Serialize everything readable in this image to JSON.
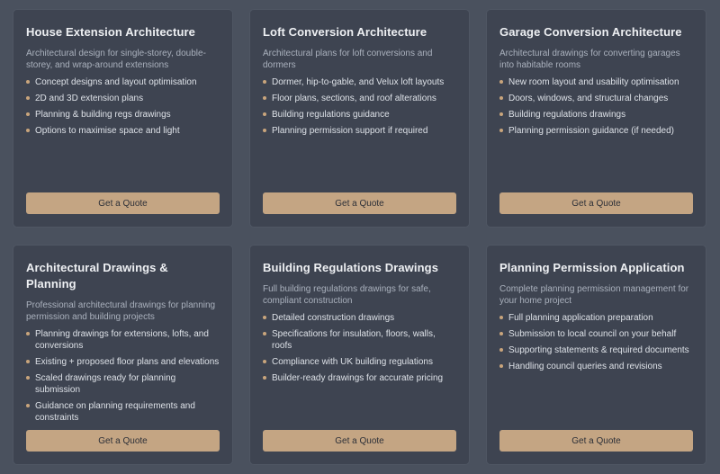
{
  "cards": [
    {
      "title": "House Extension Architecture",
      "description": "Architectural design for single-storey, double-storey, and wrap-around extensions",
      "features": [
        "Concept designs and layout optimisation",
        "2D and 3D extension plans",
        "Planning & building regs drawings",
        "Options to maximise space and light"
      ],
      "button": "Get a Quote"
    },
    {
      "title": "Loft Conversion Architecture",
      "description": "Architectural plans for loft conversions and dormers",
      "features": [
        "Dormer, hip-to-gable, and Velux loft layouts",
        "Floor plans, sections, and roof alterations",
        "Building regulations guidance",
        "Planning permission support if required"
      ],
      "button": "Get a Quote"
    },
    {
      "title": "Garage Conversion Architecture",
      "description": "Architectural drawings for converting garages into habitable rooms",
      "features": [
        "New room layout and usability optimisation",
        "Doors, windows, and structural changes",
        "Building regulations drawings",
        "Planning permission guidance (if needed)"
      ],
      "button": "Get a Quote"
    },
    {
      "title": "Architectural Drawings & Planning",
      "description": "Professional architectural drawings for planning permission and building projects",
      "features": [
        "Planning drawings for extensions, lofts, and conversions",
        "Existing + proposed floor plans and elevations",
        "Scaled drawings ready for planning submission",
        "Guidance on planning requirements and constraints"
      ],
      "button": "Get a Quote"
    },
    {
      "title": "Building Regulations Drawings",
      "description": "Full building regulations drawings for safe, compliant construction",
      "features": [
        "Detailed construction drawings",
        "Specifications for insulation, floors, walls, roofs",
        "Compliance with UK building regulations",
        "Builder-ready drawings for accurate pricing"
      ],
      "button": "Get a Quote"
    },
    {
      "title": "Planning Permission Application",
      "description": "Complete planning permission management for your home project",
      "features": [
        "Full planning application preparation",
        "Submission to local council on your behalf",
        "Supporting statements & required documents",
        "Handling council queries and revisions"
      ],
      "button": "Get a Quote"
    }
  ]
}
